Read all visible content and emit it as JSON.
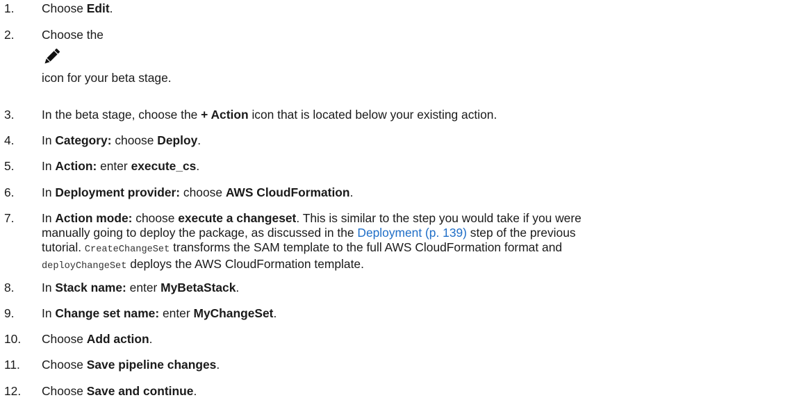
{
  "steps": [
    {
      "num": "1.",
      "pre": "Choose ",
      "b1": "Edit",
      "post": "."
    },
    {
      "num": "2.",
      "text_a": "Choose the",
      "icon": "pencil-icon",
      "text_b": "icon for your beta stage."
    },
    {
      "num": "3.",
      "pre": "In the beta stage, choose the ",
      "b1": "+ Action",
      "post": " icon that is located below your existing action."
    },
    {
      "num": "4.",
      "pre": "In ",
      "b1": "Category:",
      "mid": " choose ",
      "b2": "Deploy",
      "post": "."
    },
    {
      "num": "5.",
      "pre": "In ",
      "b1": "Action:",
      "mid": " enter ",
      "b2": "execute_cs",
      "post": "."
    },
    {
      "num": "6.",
      "pre": "In ",
      "b1": "Deployment provider:",
      "mid": " choose ",
      "b2": "AWS CloudFormation",
      "post": "."
    },
    {
      "num": "7.",
      "pre": "In ",
      "b1": "Action mode:",
      "mid": "  choose ",
      "b2": "execute a changeset",
      "post1": ". This is similar to the step you would take if you were",
      "line2_pre": "manually going to deploy the package, as discussed in the ",
      "link": "Deployment (p. 139)",
      "line2_post": " step of the previous",
      "line3_pre": "tutorial. ",
      "code1": "CreateChangeSet",
      "line3_post": " transforms the SAM template to the full AWS CloudFormation format and",
      "code2": "deployChangeSet",
      "line4_post": " deploys the AWS CloudFormation template."
    },
    {
      "num": "8.",
      "pre": "In ",
      "b1": "Stack name:",
      "mid": "  enter ",
      "b2": "MyBetaStack",
      "post": "."
    },
    {
      "num": "9.",
      "pre": "In ",
      "b1": "Change set name:",
      "mid": "  enter ",
      "b2": "MyChangeSet",
      "post": "."
    },
    {
      "num": "10.",
      "pre": "Choose ",
      "b1": "Add action",
      "post": "."
    },
    {
      "num": "11.",
      "pre": "Choose ",
      "b1": "Save pipeline changes",
      "post": "."
    },
    {
      "num": "12.",
      "pre": "Choose ",
      "b1": "Save and continue",
      "post": "."
    }
  ],
  "colors": {
    "text": "#1a1a1a",
    "link": "#1f6ec7",
    "code": "#333333"
  }
}
